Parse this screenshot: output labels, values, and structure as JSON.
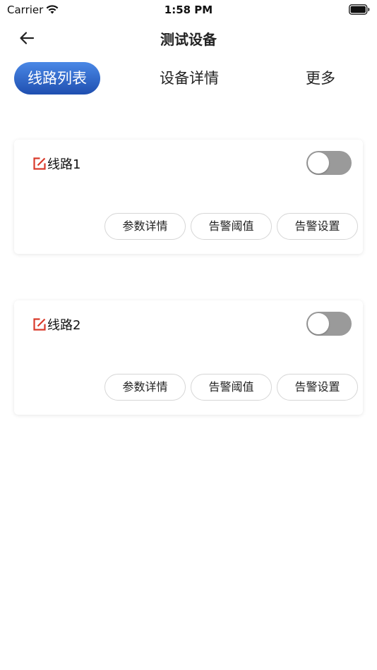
{
  "status_bar": {
    "carrier": "Carrier",
    "time": "1:58 PM",
    "wifi_icon": "wifi-icon",
    "battery_icon": "battery-icon"
  },
  "nav": {
    "title": "测试设备",
    "back_icon": "arrow-left-icon"
  },
  "tabs": [
    {
      "label": "线路列表",
      "active": true
    },
    {
      "label": "设备详情",
      "active": false
    },
    {
      "label": "更多",
      "active": false
    }
  ],
  "lines": [
    {
      "name": "线路1",
      "switch_on": false,
      "buttons": [
        "参数详情",
        "告警阈值",
        "告警设置"
      ]
    },
    {
      "name": "线路2",
      "switch_on": false,
      "buttons": [
        "参数详情",
        "告警阈值",
        "告警设置"
      ]
    }
  ],
  "colors": {
    "tab_active_top": "#4a88e6",
    "tab_active_bottom": "#1f4fb0",
    "edit_icon": "#d93a2b",
    "toggle_off": "#9a9a9a"
  }
}
